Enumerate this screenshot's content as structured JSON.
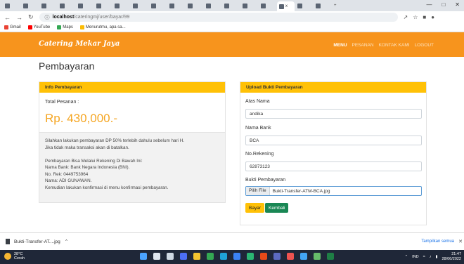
{
  "browser": {
    "url_host": "localhost",
    "url_path": "/cateringmj/user/bayar/99",
    "tab_label": "x",
    "bookmarks": [
      {
        "label": "Gmail",
        "color": "#ea4335"
      },
      {
        "label": "YouTube",
        "color": "#ff0000"
      },
      {
        "label": "Maps",
        "color": "#34a853"
      },
      {
        "label": "Menurutmu, apa sa...",
        "color": "#fbbc05"
      }
    ]
  },
  "site": {
    "brand": "Catering Mekar Jaya",
    "menu": [
      "MENU",
      "PESANAN",
      "KONTAK KAMI",
      "LOGOUT"
    ],
    "accent": "#f7941d"
  },
  "page": {
    "title": "Pembayaran"
  },
  "info": {
    "header": "Info Pembayaran",
    "total_label": "Total Pesanan :",
    "total_value": "Rp. 430,000.-",
    "lines": [
      "Silahkan lakukan pembayaran DP 50% terlebih dahulu sebelum hari H.",
      "Jika tidak maka transaksi akan di batalkan.",
      "",
      "Pembayaran Bisa Melalui Rekening Di Bawah Ini:",
      "Nama Bank: Bank Negara Indonesia (BNI).",
      "No. Rek: 0449753964",
      "Nama: ADI GUNAWAN.",
      "Kemudian lakukan konfirmasi di menu konfirmasi pembayaran."
    ]
  },
  "upload": {
    "header": "Upload Bukti Pembayaran",
    "name_label": "Atas Nama",
    "name_value": "andika",
    "bank_label": "Nama Bank",
    "bank_value": "BCA",
    "rek_label": "No.Rekening",
    "rek_value": "62873123",
    "proof_label": "Bukti Pembayaran",
    "file_button": "Pilih File",
    "file_name": "Bukti-Transfer-ATM-BCA.jpg",
    "pay_button": "Bayar",
    "back_button": "Kembali"
  },
  "download": {
    "file": "Bukti-Transfer-AT....jpg",
    "show_all": "Tampilkan semua"
  },
  "taskbar": {
    "temp": "28°C",
    "weather": "Cerah",
    "lang": "IND",
    "time": "21:47",
    "date": "28/06/2022"
  }
}
